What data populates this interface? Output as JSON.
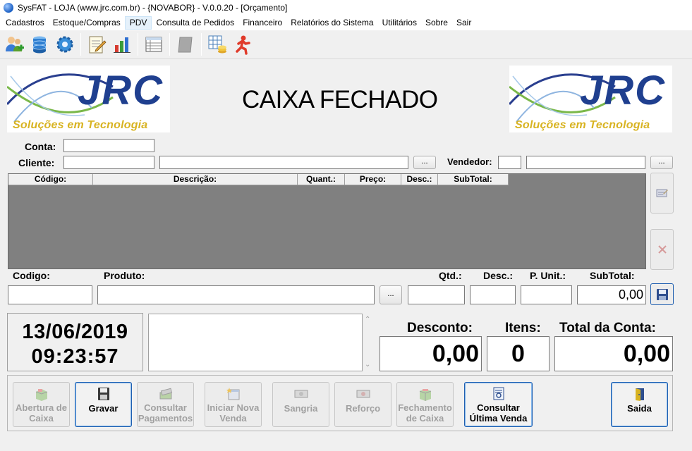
{
  "window": {
    "title": "SysFAT - LOJA (www.jrc.com.br) - {NOVABOR} - V.0.0.20 - [Orçamento]"
  },
  "menu": [
    {
      "label": "Cadastros"
    },
    {
      "label": "Estoque/Compras"
    },
    {
      "label": "PDV"
    },
    {
      "label": "Consulta de Pedidos"
    },
    {
      "label": "Financeiro"
    },
    {
      "label": "Relatórios do Sistema"
    },
    {
      "label": "Utilitários"
    },
    {
      "label": "Sobre"
    },
    {
      "label": "Sair"
    }
  ],
  "toolbar": {
    "icons": [
      "users-add-icon",
      "database-icon",
      "settings-gear-icon",
      "notepad-edit-icon",
      "bar-chart-icon",
      "spreadsheet-icon",
      "disabled-book-icon",
      "calculator-coins-icon",
      "running-man-icon"
    ]
  },
  "header": {
    "logo_text": "JRC",
    "logo_tagline": "Soluções em Tecnologia",
    "status": "CAIXA FECHADO"
  },
  "form": {
    "conta_label": "Conta:",
    "conta_value": "",
    "cliente_label": "Cliente:",
    "cliente_code": "",
    "cliente_name": "",
    "vendedor_label": "Vendedor:",
    "vendedor_code": "",
    "vendedor_name": "",
    "ellipsis": "..."
  },
  "grid": {
    "columns": [
      "Código:",
      "Descrição:",
      "Quant.:",
      "Preço:",
      "Desc.:",
      "SubTotal:"
    ],
    "rows": []
  },
  "entry": {
    "codigo_label": "Codigo:",
    "produto_label": "Produto:",
    "qtd_label": "Qtd.:",
    "desc_label": "Desc.:",
    "punit_label": "P. Unit.:",
    "subtotal_label": "SubTotal:",
    "codigo_value": "",
    "produto_value": "",
    "qtd_value": "",
    "desc_value": "",
    "punit_value": "",
    "subtotal_value": "0,00"
  },
  "datetime": {
    "date": "13/06/2019",
    "time": "09:23:57"
  },
  "totals": {
    "desconto_label": "Desconto:",
    "desconto_value": "0,00",
    "itens_label": "Itens:",
    "itens_value": "0",
    "total_label": "Total da Conta:",
    "total_value": "0,00"
  },
  "actions": [
    {
      "label": "Abertura de Caixa",
      "enabled": false
    },
    {
      "label": "Gravar",
      "enabled": true
    },
    {
      "label": "Consultar Pagamentos",
      "enabled": false
    },
    {
      "label": "Iniciar Nova Venda",
      "enabled": false
    },
    {
      "label": "Sangria",
      "enabled": false
    },
    {
      "label": "Reforço",
      "enabled": false
    },
    {
      "label": "Fechamento de Caixa",
      "enabled": false
    },
    {
      "label": "Consultar Última Venda",
      "enabled": true
    },
    {
      "label": "Saida",
      "enabled": true
    }
  ],
  "colors": {
    "grid_bg": "#808080",
    "logo_blue": "#1f3f8f",
    "logo_tagline": "#d8b321"
  }
}
